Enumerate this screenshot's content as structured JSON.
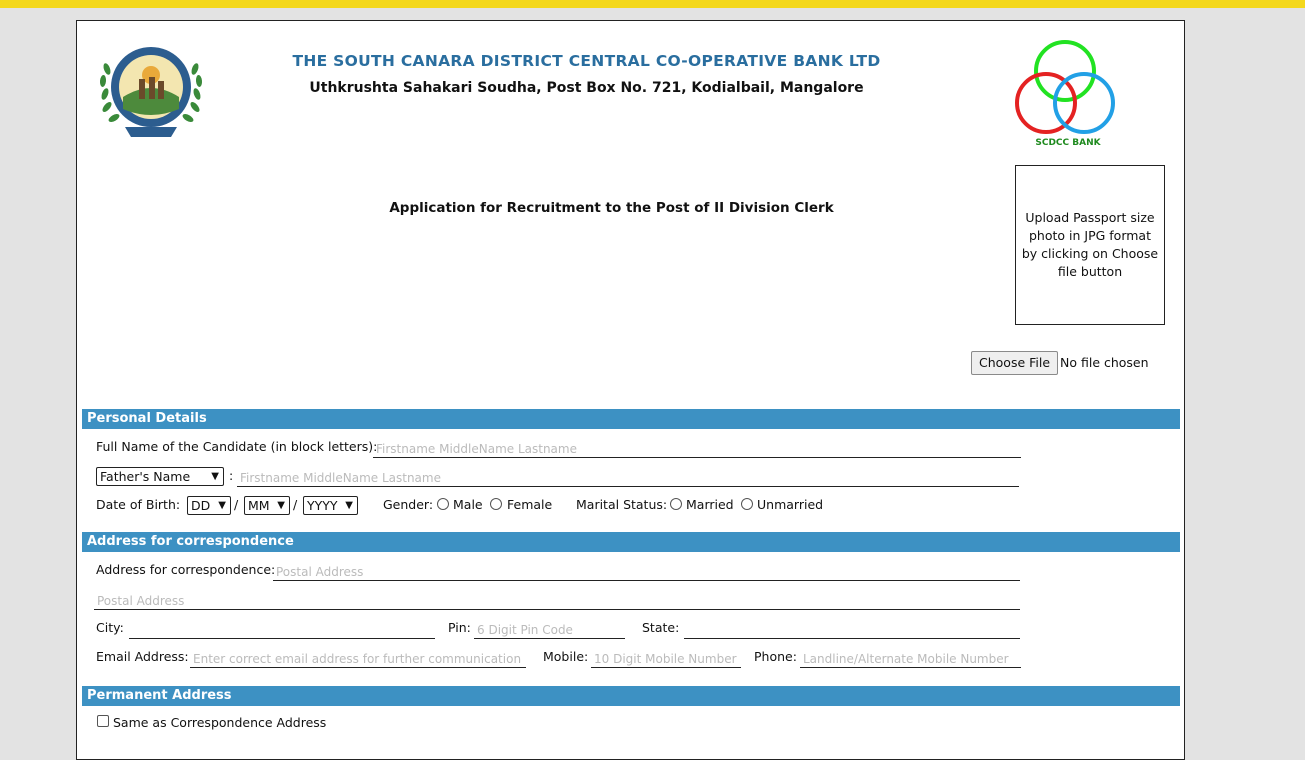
{
  "header": {
    "bank_name": "THE SOUTH CANARA DISTRICT CENTRAL CO-OPERATIVE BANK LTD",
    "bank_address": "Uthkrushta Sahakari Soudha, Post Box No. 721, Kodialbail, Mangalore",
    "right_logo_caption": "SCDCC BANK"
  },
  "form_title": "Application for Recruitment to the Post of II Division Clerk",
  "photo": {
    "instructions": "Upload Passport size photo in JPG format by clicking on Choose file button",
    "choose_file_label": "Choose File",
    "file_status": "No file chosen"
  },
  "personal": {
    "section_title": "Personal Details",
    "full_name_label": "Full Name of the Candidate (in block letters):",
    "full_name_placeholder": "Firstname MiddleName Lastname",
    "relation_select": "Father's Name",
    "relation_sep": ":",
    "relation_placeholder": "Firstname MiddleName Lastname",
    "dob_label": "Date of Birth:",
    "dob_day": "DD",
    "dob_month": "MM",
    "dob_year": "YYYY",
    "dob_sep": "/",
    "gender_label": "Gender:",
    "gender_options": [
      "Male",
      "Female"
    ],
    "marital_label": "Marital Status:",
    "marital_options": [
      "Married",
      "Unmarried"
    ]
  },
  "correspondence": {
    "section_title": "Address for correspondence",
    "address_label": "Address for correspondence:",
    "address_placeholder_1": "Postal Address",
    "address_placeholder_2": "Postal Address",
    "city_label": "City:",
    "city_value": "",
    "pin_label": "Pin:",
    "pin_placeholder": "6 Digit Pin Code",
    "state_label": "State:",
    "state_value": "",
    "email_label": "Email Address:",
    "email_placeholder": "Enter correct email address for further communication",
    "mobile_label": "Mobile:",
    "mobile_placeholder": "10 Digit Mobile Number",
    "phone_label": "Phone:",
    "phone_placeholder": "Landline/Alternate Mobile Number"
  },
  "permanent": {
    "section_title": "Permanent Address",
    "same_as_label": "Same as Correspondence Address"
  },
  "colors": {
    "top_bar": "#f4d81c",
    "section_bar": "#3d91c3",
    "bank_name": "#2a6e9f"
  }
}
